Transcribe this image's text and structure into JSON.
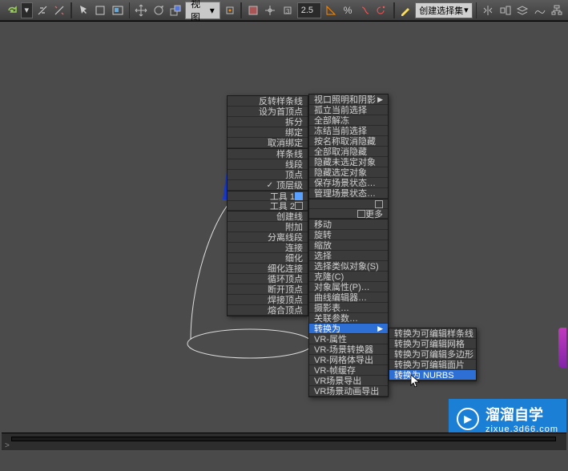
{
  "toolbar": {
    "view_btn": "视图",
    "coord_input": "2.5",
    "selset_combo": "创建选择集"
  },
  "menu_left": [
    {
      "label": "反转样条线"
    },
    {
      "label": "设为首顶点"
    },
    {
      "label": "拆分"
    },
    {
      "label": "绑定"
    },
    {
      "label": "取消绑定"
    },
    {
      "sep": true
    },
    {
      "label": "样条线"
    },
    {
      "label": "线段"
    },
    {
      "label": "顶点"
    },
    {
      "label": "顶层级",
      "check": true
    },
    {
      "sep": true
    },
    {
      "label": "工具 1",
      "tools": true,
      "blue": true
    },
    {
      "label": "工具 2",
      "tools": true
    },
    {
      "sep": true
    },
    {
      "label": "创建线"
    },
    {
      "label": "附加"
    },
    {
      "label": "分离线段"
    },
    {
      "label": "连接"
    },
    {
      "label": "细化"
    },
    {
      "label": "细化连接"
    },
    {
      "label": "循环顶点"
    },
    {
      "label": "断开顶点"
    },
    {
      "label": "焊接顶点"
    },
    {
      "label": "熔合顶点"
    }
  ],
  "menu_mid": [
    {
      "label": "视口照明和阴影",
      "arrow": true
    },
    {
      "label": "孤立当前选择"
    },
    {
      "label": "全部解冻"
    },
    {
      "label": "冻结当前选择"
    },
    {
      "label": "按名称取消隐藏"
    },
    {
      "label": "全部取消隐藏"
    },
    {
      "label": "隐藏未选定对象"
    },
    {
      "label": "隐藏选定对象"
    },
    {
      "label": "保存场景状态…"
    },
    {
      "label": "管理场景状态…"
    },
    {
      "sep": true
    },
    {
      "label": "",
      "tools": true
    },
    {
      "label": "更多",
      "tools_right": true
    },
    {
      "sep": true
    },
    {
      "label": "移动"
    },
    {
      "label": "旋转"
    },
    {
      "label": "缩放"
    },
    {
      "label": "选择"
    },
    {
      "label": "选择类似对象(S)"
    },
    {
      "label": "克隆(C)"
    },
    {
      "label": "对象属性(P)…"
    },
    {
      "label": "曲线编辑器…"
    },
    {
      "label": "摄影表…"
    },
    {
      "label": "关联参数…"
    },
    {
      "label": "转换为",
      "arrow": true,
      "hl": true
    },
    {
      "label": "VR-属性"
    },
    {
      "label": "VR-场景转换器"
    },
    {
      "label": "VR-网格体导出"
    },
    {
      "label": "VR-帧缓存"
    },
    {
      "label": "VR场景导出"
    },
    {
      "label": "VR场景动画导出"
    }
  ],
  "menu_sub": [
    {
      "label": "转换为可编辑样条线"
    },
    {
      "label": "转换为可编辑网格"
    },
    {
      "label": "转换为可编辑多边形"
    },
    {
      "label": "转换为可编辑面片"
    },
    {
      "label": "转换为 NURBS",
      "hl": true
    }
  ],
  "watermark": {
    "brand": "溜溜自学",
    "url": "zixue.3d66.com"
  },
  "timeline": {
    "prompt": ">"
  }
}
